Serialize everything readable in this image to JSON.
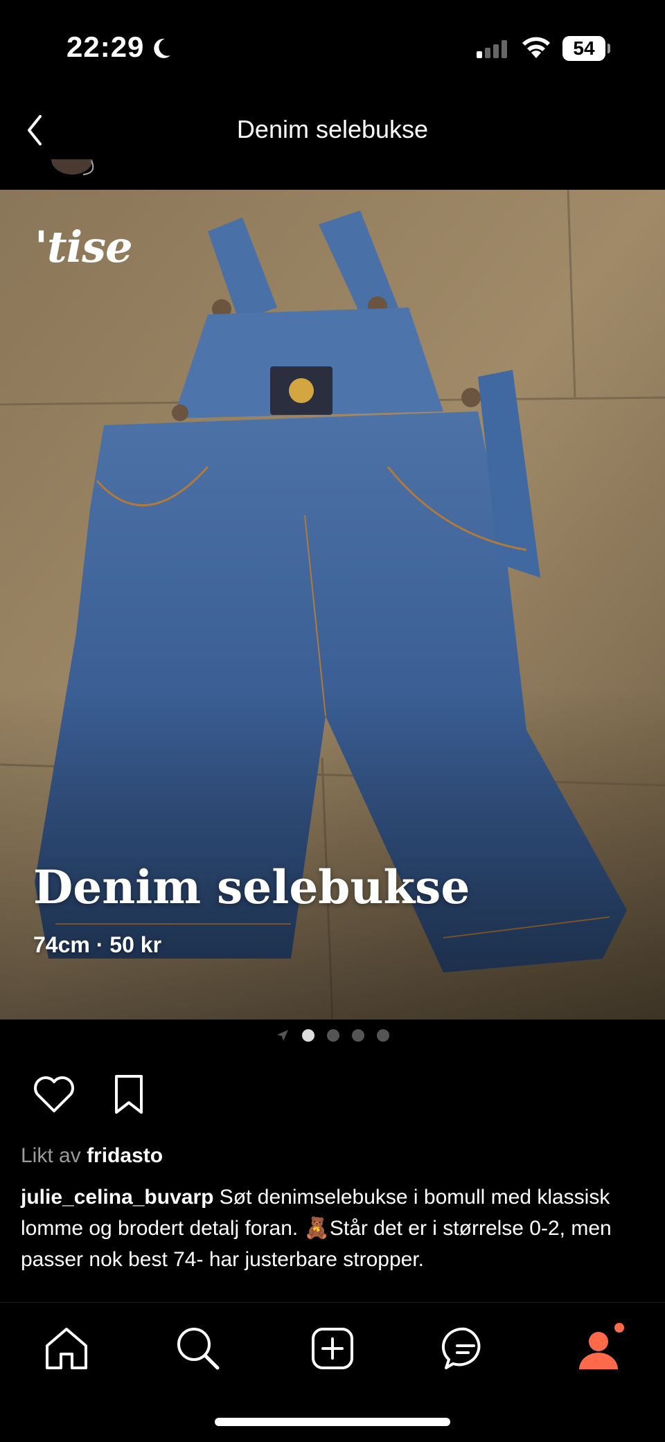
{
  "status": {
    "time": "22:29",
    "battery": "54"
  },
  "header": {
    "title": "Denim selebukse"
  },
  "photo": {
    "logo": "'tise",
    "overlay_title": "Denim selebukse",
    "overlay_sub": "74cm · 50 kr"
  },
  "carousel": {
    "count": 4,
    "active": 0
  },
  "likes": {
    "prefix": "Likt av",
    "user": "fridasto"
  },
  "caption": {
    "user": "julie_celina_buvarp",
    "text": "Søt denimselebukse i bomull med klassisk lomme og brodert detalj foran. 🧸Står det er i størrelse 0-2, men passer nok best 74- har justerbare stropper."
  },
  "colors": {
    "accent": "#ff6b4a",
    "background": "#000000"
  },
  "icons": [
    "back-icon",
    "heart-icon",
    "bookmark-icon",
    "home-icon",
    "search-icon",
    "add-icon",
    "messages-icon",
    "profile-icon"
  ]
}
